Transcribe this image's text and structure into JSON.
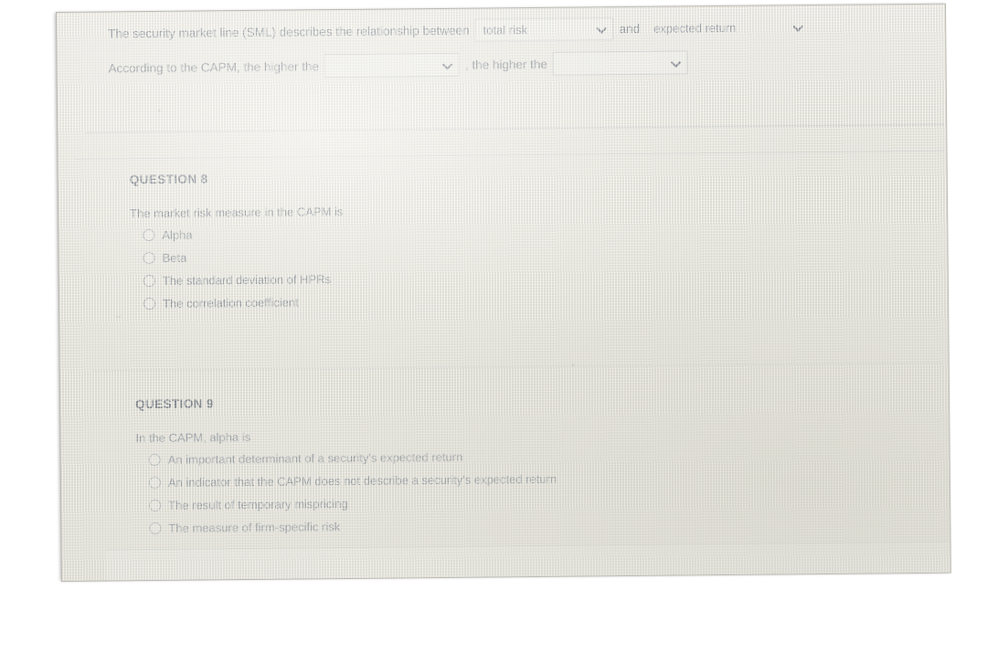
{
  "top_question": {
    "line1": {
      "prefix": "The security market line (SML) describes the relationship between",
      "dropdown1_value": "total risk",
      "middle": "and",
      "dropdown2_value": "expected return"
    },
    "line2": {
      "prefix": "According to the CAPM, the higher the",
      "dropdown1_value": "",
      "middle": ", the higher the",
      "dropdown2_value": ""
    }
  },
  "question8": {
    "title": "QUESTION 8",
    "stem": "The market risk measure in the CAPM is",
    "options": [
      "Alpha",
      "Beta",
      "The standard deviation of HPRs",
      "The correlation coefficient"
    ]
  },
  "question9": {
    "title": "QUESTION 9",
    "stem": "In the CAPM, alpha is",
    "options": [
      "An important determinant of a security's expected return",
      "An indicator that the CAPM does not describe a security's expected return",
      "The result of temporary mispricing",
      "The measure of firm-specific risk"
    ]
  },
  "icons": {
    "chevron": "chevron-down-icon",
    "radio": "radio-button-unchecked-icon"
  },
  "colors": {
    "screen_bg": "#eceae1",
    "text": "#5f6a78",
    "divider": "#b9bcc2",
    "field_border": "#c3c5c6"
  }
}
